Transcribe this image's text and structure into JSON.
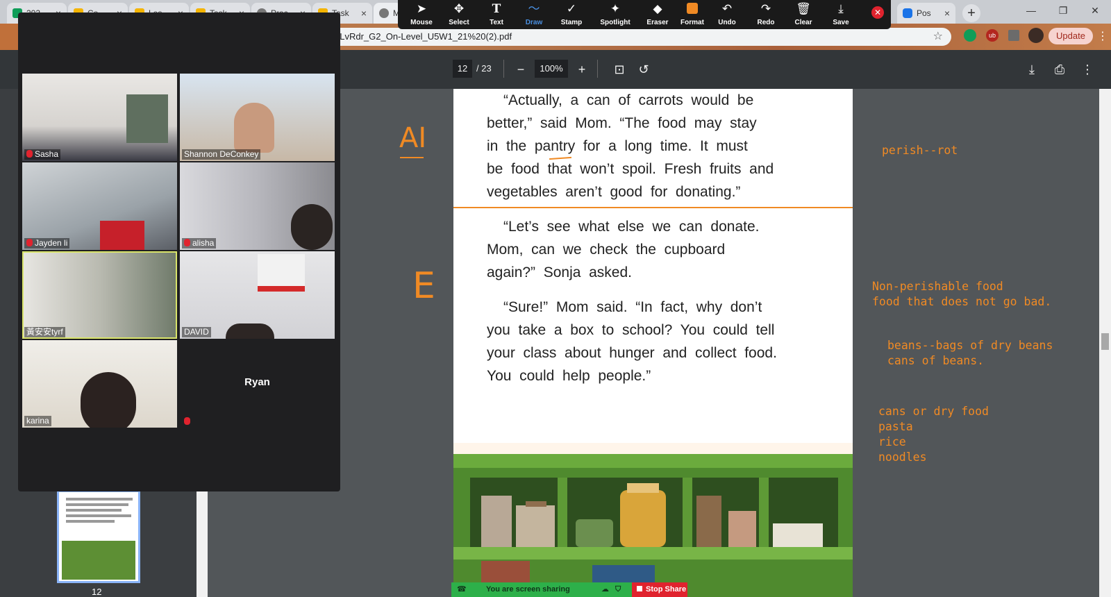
{
  "browser": {
    "tabs": [
      {
        "label": "202",
        "color": "#0f9d58"
      },
      {
        "label": "Co",
        "color": "#f4b400"
      },
      {
        "label": "Les",
        "color": "#f4b400"
      },
      {
        "label": "Task",
        "color": "#f4b400"
      },
      {
        "label": "Prac",
        "color": "#777777"
      },
      {
        "label": "Task",
        "color": "#f4b400"
      },
      {
        "label": "MI",
        "color": "#777777"
      },
      {
        "label": "Pos",
        "color": "#1a73e8"
      }
    ],
    "new_tab_glyph": "+",
    "url": "_LvRdr_G2_On-Level_U5W1_21%20(2).pdf",
    "update_label": "Update"
  },
  "annotate_toolbar": {
    "tools": [
      "Mouse",
      "Select",
      "Text",
      "Draw",
      "Stamp",
      "Spotlight",
      "Eraser",
      "Format",
      "Undo",
      "Redo",
      "Clear",
      "Save"
    ],
    "active": "Draw"
  },
  "pdf_toolbar": {
    "page_current": "12",
    "page_total": "/ 23",
    "zoom": "100%"
  },
  "sidebar": {
    "thumbnail_page": "12"
  },
  "page_text": {
    "p1_lines": [
      "“Actually,  a  can  of  carrots  would  be",
      "better,”  said  Mom.  “The  food  may  stay",
      "in  the  pantry  for  a  long  time.  It  must",
      "be  food  that  won’t  spoil.  Fresh  fruits  and",
      "vegetables  aren’t  good  for  donating.”"
    ],
    "p2_lines": [
      "“Let’s  see  what  else  we  can  donate.",
      "Mom,  can  we  check  the  cupboard",
      "again?”  Sonja  asked."
    ],
    "p3_lines": [
      "“Sure!”  Mom  said.  “In  fact,  why  don’t",
      "you  take  a  box  to  school?  You  could  tell",
      "your  class  about  hunger  and  collect  food.",
      "You  could  help  people.”"
    ]
  },
  "annotations": {
    "margin_left_1": "AI",
    "margin_left_2": "E",
    "note_1": "perish--rot",
    "note_2_lines": [
      "Non-perishable food",
      "food that does not go bad."
    ],
    "note_3_lines": [
      "beans--bags of dry beans",
      "cans of beans."
    ],
    "note_4_lines": [
      "cans or dry food",
      "pasta",
      "rice",
      "noodles"
    ]
  },
  "zoom": {
    "participants": [
      {
        "name": "Sasha",
        "muted": true
      },
      {
        "name": "Shannon DeConkey",
        "muted": false
      },
      {
        "name": "Jayden li",
        "muted": true
      },
      {
        "name": "alisha",
        "muted": true
      },
      {
        "name": "黃安安tyrf",
        "muted": false
      },
      {
        "name": "DAVID",
        "muted": false
      },
      {
        "name": "karina",
        "muted": false
      },
      {
        "name": "Ryan",
        "muted": true
      }
    ],
    "sharing_status": "You are screen sharing",
    "stop_share": "Stop Share"
  },
  "colors": {
    "annotation_orange": "#f08a24",
    "stop_share_red": "#e0232e",
    "share_bar_green": "#2db04a"
  }
}
